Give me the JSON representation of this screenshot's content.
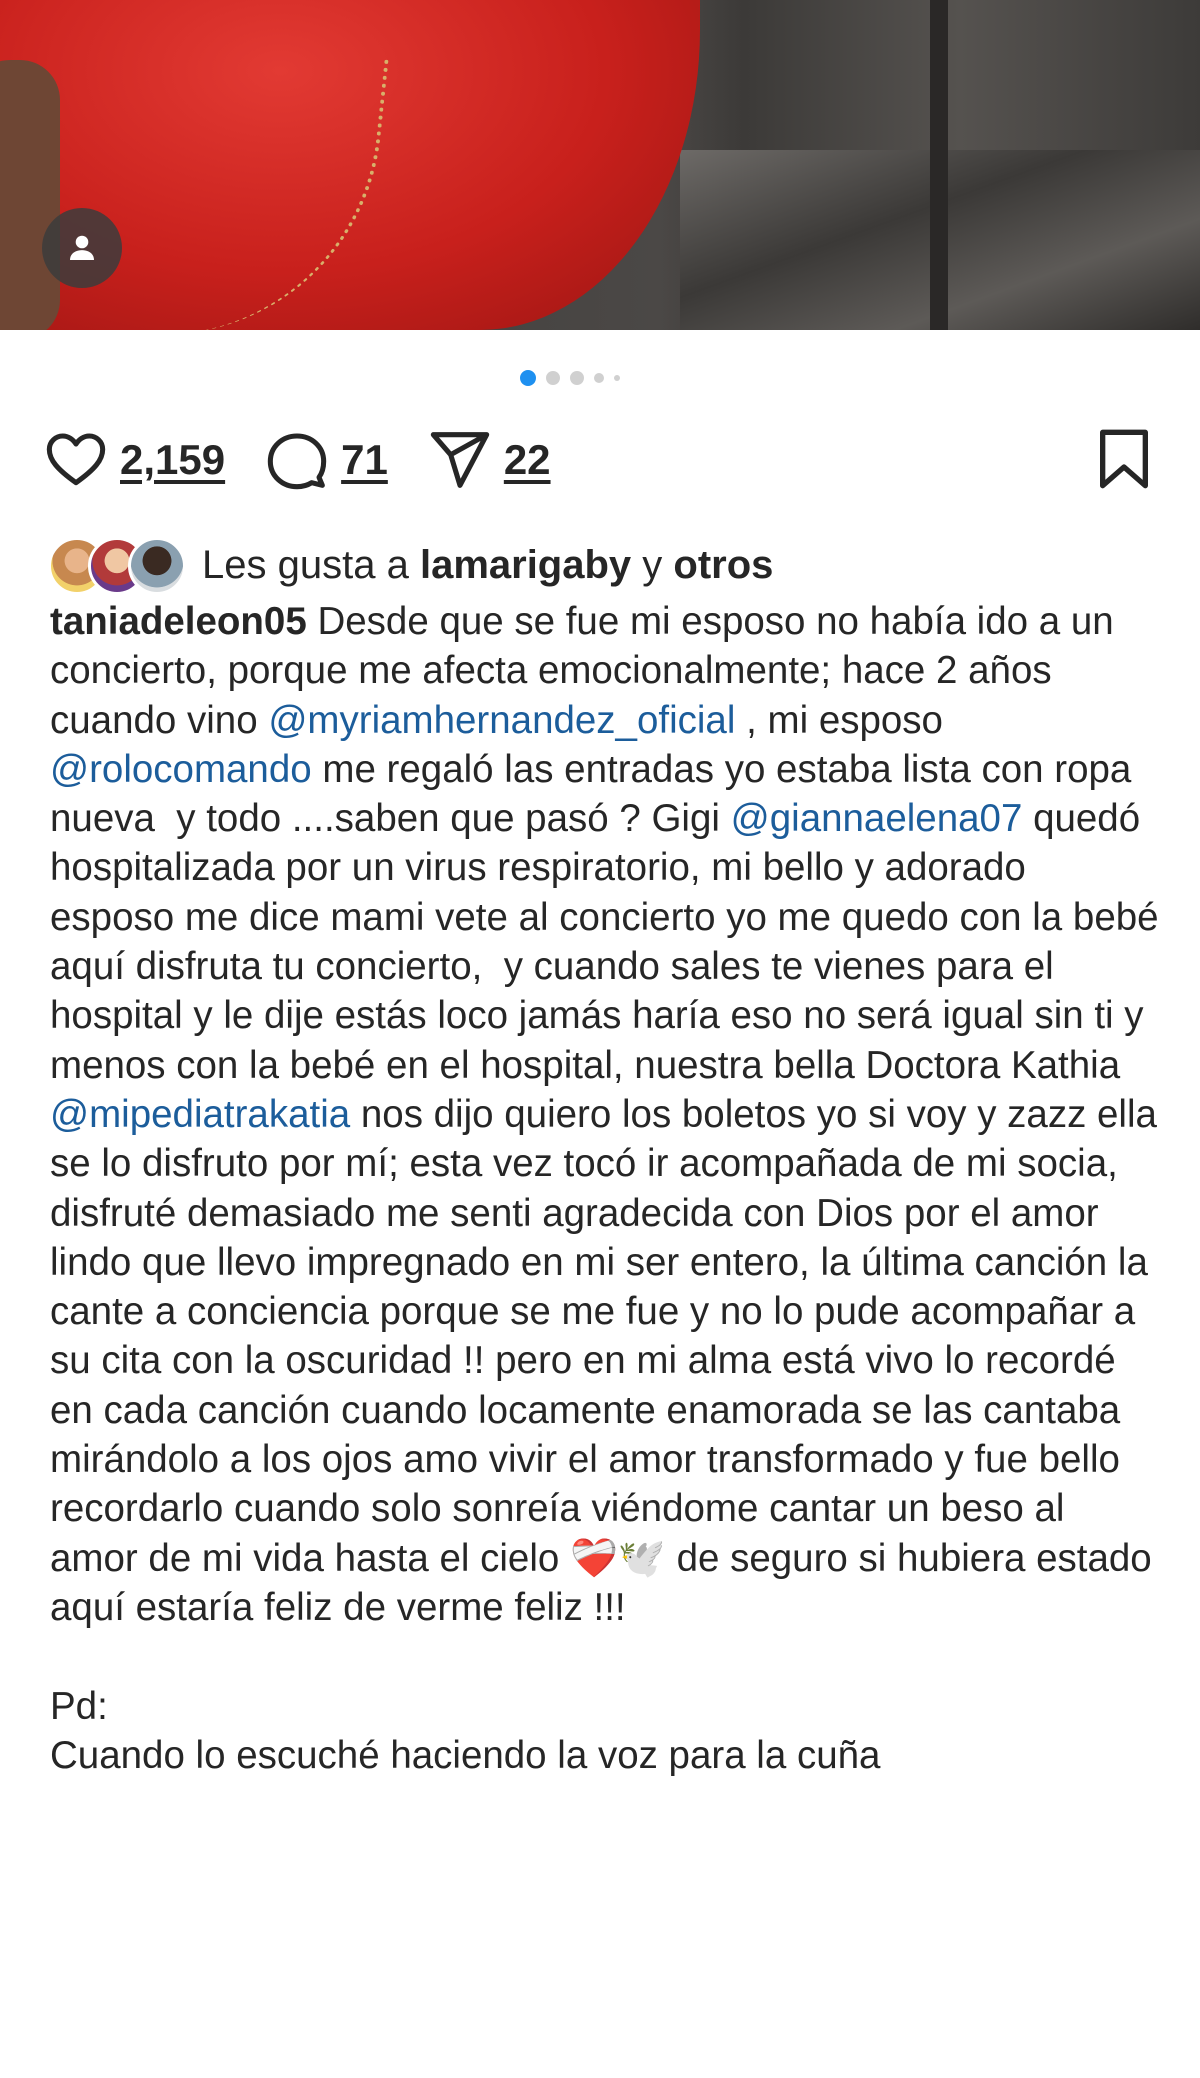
{
  "post": {
    "image_alt_icon": "user-tag-icon",
    "carousel": {
      "total": 5,
      "active": 1
    },
    "likes_count": "2,159",
    "comments_count": "71",
    "shares_count": "22",
    "liked_by": {
      "prefix": "Les gusta a",
      "user": "lamarigaby",
      "connector": "y",
      "others": "otros"
    },
    "caption": {
      "username": "taniadeleon05",
      "segments": [
        {
          "type": "text",
          "value": " Desde que se fue mi esposo no había ido a un concierto, porque me afecta emocionalmente; hace 2 años cuando vino "
        },
        {
          "type": "mention",
          "value": "@myriamhernandez_oficial"
        },
        {
          "type": "text",
          "value": " , mi esposo "
        },
        {
          "type": "mention",
          "value": "@rolocomando"
        },
        {
          "type": "text",
          "value": " me regaló las entradas yo estaba lista con ropa nueva  y todo ....saben que pasó ? Gigi "
        },
        {
          "type": "mention",
          "value": "@giannaelena07"
        },
        {
          "type": "text",
          "value": " quedó hospitalizada por un virus respiratorio, mi bello y adorado esposo me dice mami vete al concierto yo me quedo con la bebé aquí disfruta tu concierto,  y cuando sales te vienes para el hospital y le dije estás loco jamás haría eso no será igual sin ti y menos con la bebé en el hospital, nuestra bella Doctora Kathia "
        },
        {
          "type": "mention",
          "value": "@mipediatrakatia"
        },
        {
          "type": "text",
          "value": " nos dijo quiero los boletos yo si voy y zazz ella se lo disfruto por mí; esta vez tocó ir acompañada de mi socia, disfruté demasiado me senti agradecida con Dios por el amor lindo que llevo impregnado en mi ser entero, la última canción la cante a conciencia porque se me fue y no lo pude acompañar a su cita con la oscuridad !! pero en mi alma está vivo lo recordé en cada canción cuando locamente enamorada se las cantaba mirándolo a los ojos amo vivir el amor transformado y fue bello recordarlo cuando solo sonreía viéndome cantar un beso al amor de mi vida hasta el cielo ❤️‍🩹🕊️ de seguro si hubiera estado aquí estaría feliz de verme feliz !!!\n\nPd:\nCuando lo escuché haciendo la voz para la cuña"
        }
      ]
    }
  }
}
